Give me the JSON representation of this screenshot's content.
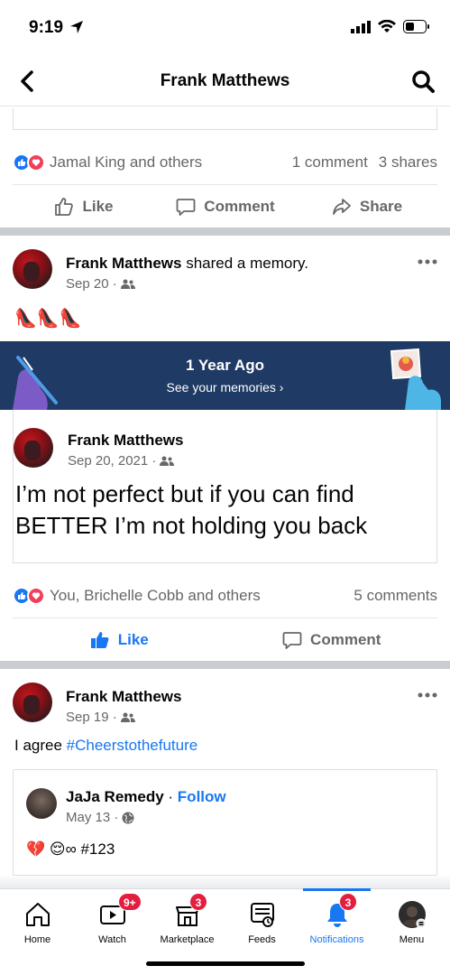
{
  "status": {
    "time": "9:19"
  },
  "nav": {
    "title": "Frank Matthews"
  },
  "post1": {
    "reactions": "Jamal King and others",
    "comments": "1 comment",
    "shares": "3 shares",
    "actions": {
      "like": "Like",
      "comment": "Comment",
      "share": "Share"
    }
  },
  "post2": {
    "author": "Frank Matthews",
    "action_text": " shared a memory.",
    "date": "Sep 20 ·",
    "caption_emoji": "👠👠👠",
    "memory_banner": {
      "title": "1 Year Ago",
      "subtitle": "See your memories ›"
    },
    "memory": {
      "author": "Frank Matthews",
      "date": "Sep 20, 2021 ·",
      "text": "I’m not perfect but if you can find BETTER I’m not holding you back"
    },
    "reactions": "You, Brichelle Cobb and others",
    "comments": "5 comments",
    "actions": {
      "like": "Like",
      "comment": "Comment"
    }
  },
  "post3": {
    "author": "Frank Matthews",
    "date": "Sep 19 ·",
    "caption_prefix": "I agree ",
    "hashtag": "#Cheerstothefuture",
    "shared": {
      "author": "JaJa Remedy",
      "separator": " · ",
      "follow": "Follow",
      "date": "May 13 ·",
      "text": "💔 😌∞ #123"
    }
  },
  "tabs": [
    {
      "label": "Home",
      "icon": "home-icon",
      "badge": ""
    },
    {
      "label": "Watch",
      "icon": "watch-icon",
      "badge": "9+"
    },
    {
      "label": "Marketplace",
      "icon": "marketplace-icon",
      "badge": "3"
    },
    {
      "label": "Feeds",
      "icon": "feeds-icon",
      "badge": ""
    },
    {
      "label": "Notifications",
      "icon": "bell-icon",
      "badge": "3"
    },
    {
      "label": "Menu",
      "icon": "menu-avatar-icon",
      "badge": ""
    }
  ],
  "colors": {
    "accent": "#1877f2",
    "badge": "#e41e3f",
    "memory_banner": "#1f3a64",
    "separator": "#c9ccd1"
  }
}
